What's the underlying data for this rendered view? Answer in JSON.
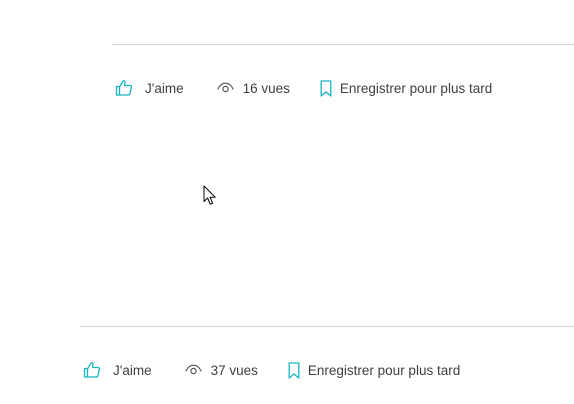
{
  "posts": [
    {
      "like_label": "J'aime",
      "views_label": "16 vues",
      "save_label": "Enregistrer pour plus tard"
    },
    {
      "like_label": "J'aime",
      "views_label": "37 vues",
      "save_label": "Enregistrer pour plus tard"
    }
  ],
  "colors": {
    "accent": "#1bb3c2",
    "text": "#404040",
    "divider": "#d4d4d4"
  },
  "icons": {
    "like": "thumbs-up-icon",
    "views": "eye-icon",
    "save": "bookmark-icon",
    "cursor": "mouse-pointer-icon"
  }
}
